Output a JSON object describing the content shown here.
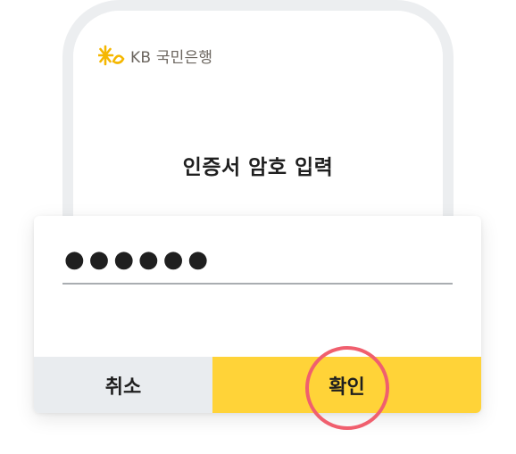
{
  "header": {
    "bank_name": "KB 국민은행",
    "logo_icon": "kb-star-icon",
    "logo_color": "#f5b700"
  },
  "screen": {
    "title": "인증서 암호 입력"
  },
  "dialog": {
    "password_value": "●●●●●●",
    "cancel_label": "취소",
    "confirm_label": "확인"
  },
  "colors": {
    "confirm_bg": "#ffd338",
    "cancel_bg": "#e9ecef",
    "highlight_ring": "#f05f6e"
  }
}
